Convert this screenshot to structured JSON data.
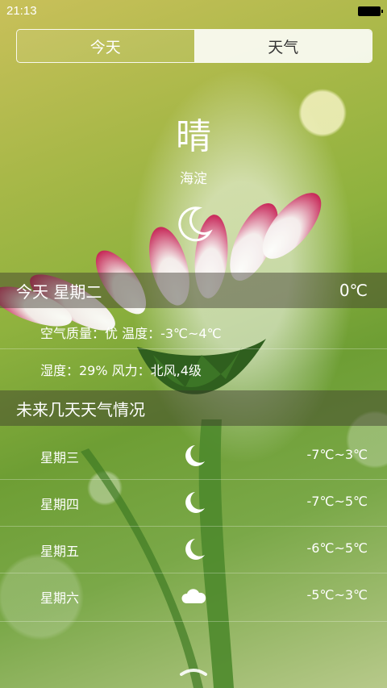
{
  "status": {
    "time": "21:13"
  },
  "tabs": [
    {
      "label": "今天"
    },
    {
      "label": "天气"
    }
  ],
  "current": {
    "condition": "晴",
    "district": "海淀",
    "icon": "moon-icon"
  },
  "today": {
    "label": "今天   星期二",
    "temp": "0℃",
    "detail_line1": "空气质量：优   温度：-3℃~4℃",
    "detail_line2": "湿度：29%    风力：北风,4级"
  },
  "forecast": {
    "title": "未来几天天气情况",
    "days": [
      {
        "day": "星期三",
        "icon": "moon-icon",
        "range": "-7℃~3℃"
      },
      {
        "day": "星期四",
        "icon": "moon-icon",
        "range": "-7℃~5℃"
      },
      {
        "day": "星期五",
        "icon": "moon-icon",
        "range": "-6℃~5℃"
      },
      {
        "day": "星期六",
        "icon": "cloud-icon",
        "range": "-5℃~3℃"
      }
    ]
  }
}
